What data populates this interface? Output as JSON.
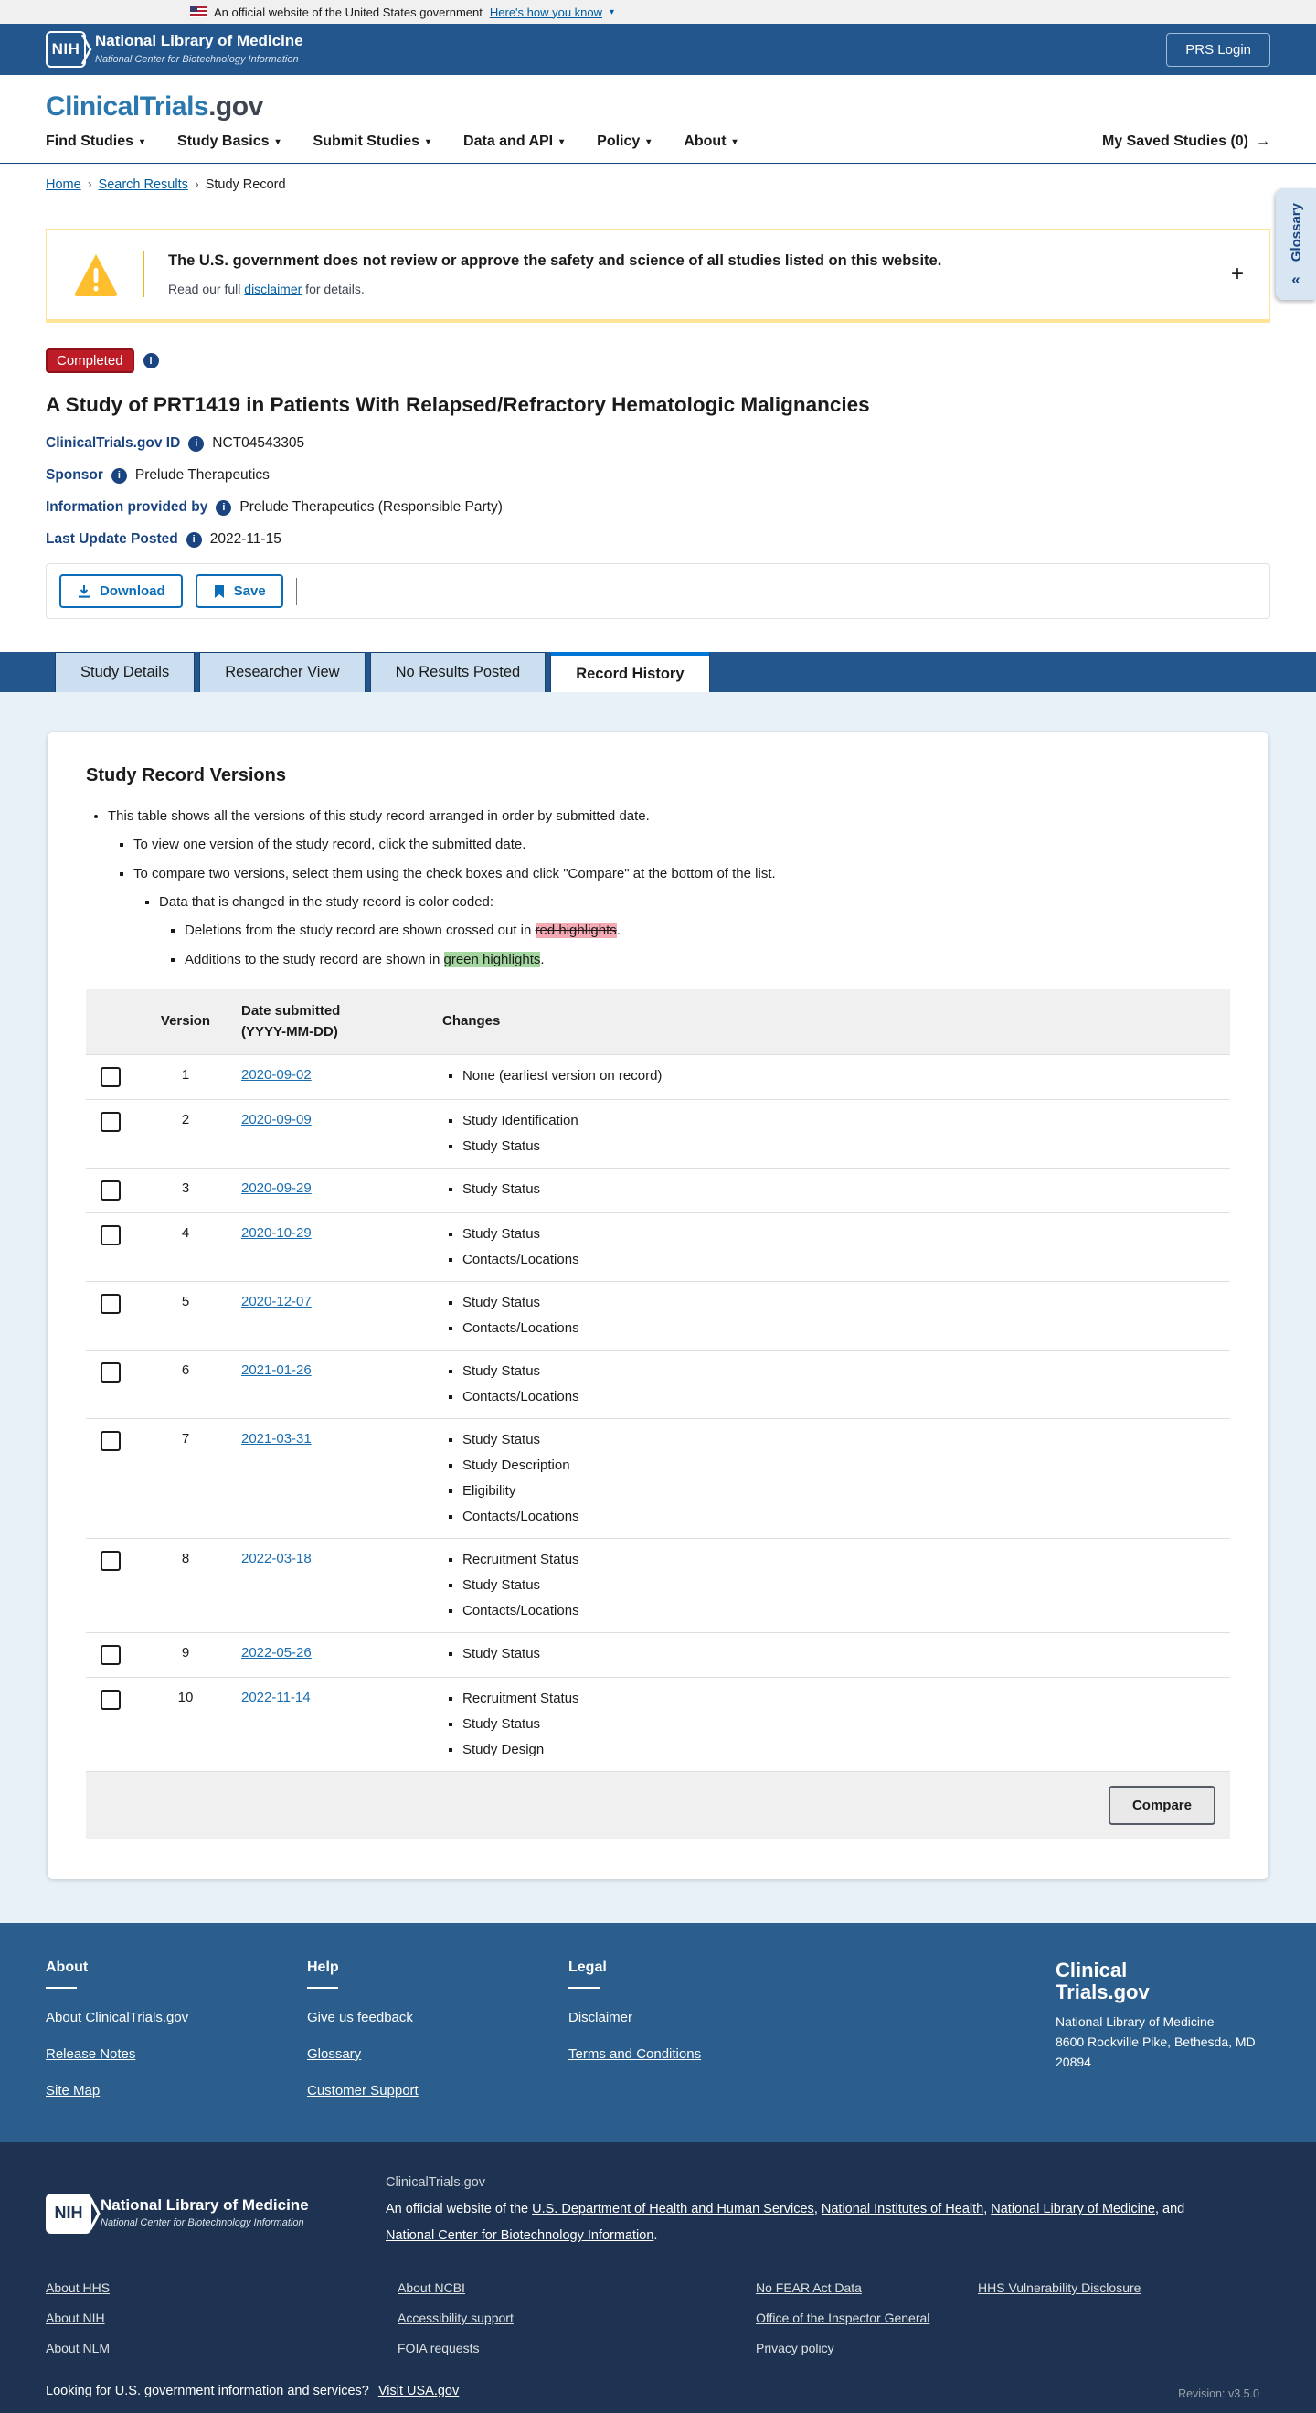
{
  "icons": {
    "chevron_down": "▾",
    "arrow_right": "→",
    "breadcrumb_sep": "›",
    "double_left": "«",
    "plus": "+",
    "info": "i"
  },
  "colors": {
    "status_red": "#bd1c27",
    "highlight_red": "#f5a9b3",
    "highlight_green": "#a3d79f",
    "accent_blue": "#0b6db8"
  },
  "gov_banner": {
    "text": "An official website of the United States government",
    "link_label": "Here's how you know"
  },
  "nih_header": {
    "acronym": "NIH",
    "title": "National Library of Medicine",
    "subtitle": "National Center for Biotechnology Information",
    "login_button": "PRS Login"
  },
  "site_header": {
    "logo_primary": "ClinicalTrials",
    "logo_suffix": ".gov",
    "nav_items": [
      "Find Studies",
      "Study Basics",
      "Submit Studies",
      "Data and API",
      "Policy",
      "About"
    ],
    "saved_studies_label": "My Saved Studies (0)"
  },
  "breadcrumb": {
    "links": [
      "Home",
      "Search Results"
    ],
    "current": "Study Record"
  },
  "glossary": {
    "label": "Glossary"
  },
  "warning": {
    "title": "The U.S. government does not review or approve the safety and science of all studies listed on this website.",
    "body_prefix": "Read our full ",
    "body_link": "disclaimer",
    "body_suffix": " for details."
  },
  "study": {
    "status_badge": "Completed",
    "title": "A Study of PRT1419 in Patients With Relapsed/Refractory Hematologic Malignancies",
    "fields": [
      {
        "label": "ClinicalTrials.gov ID",
        "value": "NCT04543305"
      },
      {
        "label": "Sponsor",
        "value": "Prelude Therapeutics"
      },
      {
        "label": "Information provided by",
        "value": "Prelude Therapeutics (Responsible Party)"
      },
      {
        "label": "Last Update Posted",
        "value": "2022-11-15"
      }
    ]
  },
  "actions": {
    "download_label": "Download",
    "save_label": "Save"
  },
  "tabs": [
    {
      "label": "Study Details",
      "active": false
    },
    {
      "label": "Researcher View",
      "active": false
    },
    {
      "label": "No Results Posted",
      "active": false
    },
    {
      "label": "Record History",
      "active": true
    }
  ],
  "record_history": {
    "heading": "Study Record Versions",
    "notes": {
      "n1": "This table shows all the versions of this study record arranged in order by submitted date.",
      "n2a": "To view one version of the study record, click the submitted date.",
      "n2b": "To compare two versions, select them using the check boxes and click \"Compare\" at the bottom of the list.",
      "n3": "Data that is changed in the study record is color coded:",
      "n4a_prefix": "Deletions from the study record are shown crossed out in ",
      "n4a_highlight": "red highlights",
      "n4a_suffix": ".",
      "n4b_prefix": "Additions to the study record are shown in ",
      "n4b_highlight": "green highlights",
      "n4b_suffix": "."
    },
    "table": {
      "headers": {
        "version": "Version",
        "date_line1": "Date submitted",
        "date_line2": "(YYYY-MM-DD)",
        "changes": "Changes"
      },
      "rows": [
        {
          "version": "1",
          "date": "2020-09-02",
          "changes": [
            "None (earliest version on record)"
          ]
        },
        {
          "version": "2",
          "date": "2020-09-09",
          "changes": [
            "Study Identification",
            "Study Status"
          ]
        },
        {
          "version": "3",
          "date": "2020-09-29",
          "changes": [
            "Study Status"
          ]
        },
        {
          "version": "4",
          "date": "2020-10-29",
          "changes": [
            "Study Status",
            "Contacts/Locations"
          ]
        },
        {
          "version": "5",
          "date": "2020-12-07",
          "changes": [
            "Study Status",
            "Contacts/Locations"
          ]
        },
        {
          "version": "6",
          "date": "2021-01-26",
          "changes": [
            "Study Status",
            "Contacts/Locations"
          ]
        },
        {
          "version": "7",
          "date": "2021-03-31",
          "changes": [
            "Study Status",
            "Study Description",
            "Eligibility",
            "Contacts/Locations"
          ]
        },
        {
          "version": "8",
          "date": "2022-03-18",
          "changes": [
            "Recruitment Status",
            "Study Status",
            "Contacts/Locations"
          ]
        },
        {
          "version": "9",
          "date": "2022-05-26",
          "changes": [
            "Study Status"
          ]
        },
        {
          "version": "10",
          "date": "2022-11-14",
          "changes": [
            "Recruitment Status",
            "Study Status",
            "Study Design"
          ]
        }
      ],
      "compare_button": "Compare"
    }
  },
  "footer": {
    "columns": [
      {
        "heading": "About",
        "links": [
          "About ClinicalTrials.gov",
          "Release Notes",
          "Site Map"
        ]
      },
      {
        "heading": "Help",
        "links": [
          "Give us feedback",
          "Glossary",
          "Customer Support"
        ]
      },
      {
        "heading": "Legal",
        "links": [
          "Disclaimer",
          "Terms and Conditions"
        ]
      }
    ],
    "brand": {
      "line1": "Clinical",
      "line2": "Trials.gov",
      "address": [
        "National Library of Medicine",
        "8600 Rockville Pike, Bethesda, MD",
        "20894"
      ]
    }
  },
  "subfooter": {
    "nih": {
      "acronym": "NIH",
      "title": "National Library of Medicine",
      "subtitle": "National Center for Biotechnology Information"
    },
    "site_name": "ClinicalTrials.gov",
    "agency_prefix": "An official website of the ",
    "agency_links": [
      "U.S. Department of Health and Human Services",
      "National Institutes of Health",
      "National Library of Medicine",
      "National Center for Biotechnology Information"
    ],
    "agency_joiners": [
      ", ",
      ", ",
      ", and "
    ],
    "agency_suffix": ".",
    "link_columns": [
      [
        "About HHS",
        "About NIH",
        "About NLM"
      ],
      [
        "About NCBI",
        "Accessibility support",
        "FOIA requests"
      ],
      [
        "No FEAR Act Data",
        "Office of the Inspector General",
        "Privacy policy"
      ],
      [
        "HHS Vulnerability Disclosure"
      ]
    ],
    "usa_line": {
      "text": "Looking for U.S. government information and services?",
      "link": "Visit USA.gov"
    },
    "revision": "Revision: v3.5.0"
  }
}
